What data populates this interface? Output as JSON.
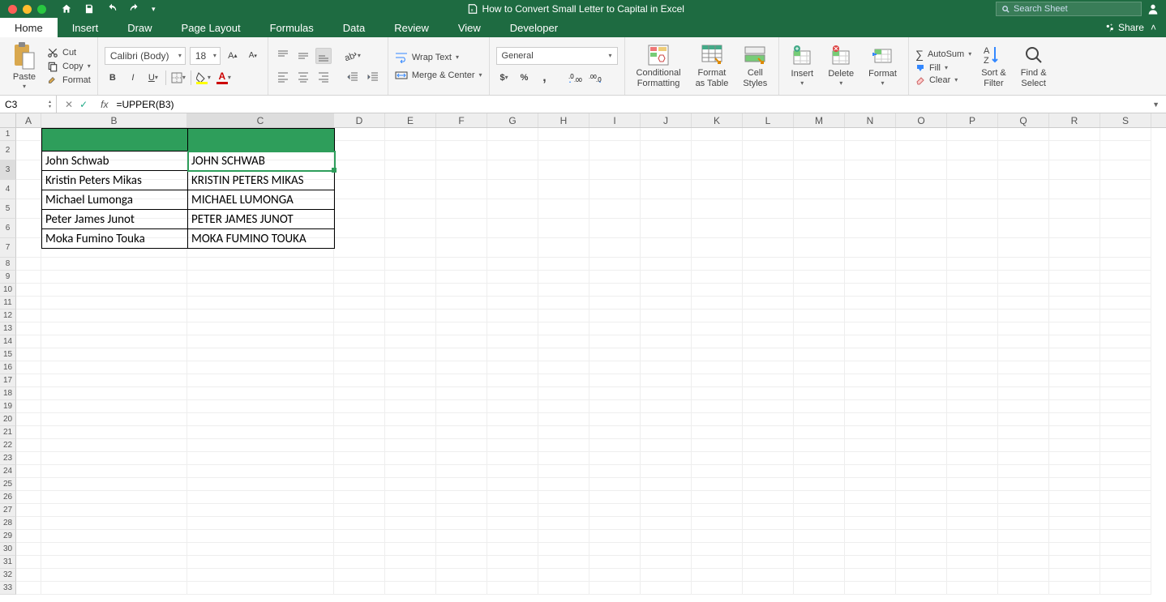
{
  "title": "How to Convert Small Letter to Capital in Excel",
  "search_placeholder": "Search Sheet",
  "tabs": [
    "Home",
    "Insert",
    "Draw",
    "Page Layout",
    "Formulas",
    "Data",
    "Review",
    "View",
    "Developer"
  ],
  "share": "Share",
  "clipboard": {
    "paste": "Paste",
    "cut": "Cut",
    "copy": "Copy",
    "format": "Format"
  },
  "font": {
    "name": "Calibri (Body)",
    "size": "18"
  },
  "align": {
    "wrap": "Wrap Text",
    "merge": "Merge & Center"
  },
  "number": {
    "format": "General"
  },
  "styles": {
    "cond": "Conditional\nFormatting",
    "tbl": "Format\nas Table",
    "cell": "Cell\nStyles"
  },
  "cells": {
    "insert": "Insert",
    "delete": "Delete",
    "format": "Format"
  },
  "editing": {
    "autosum": "AutoSum",
    "fill": "Fill",
    "clear": "Clear",
    "sort": "Sort &\nFilter",
    "find": "Find &\nSelect"
  },
  "namebox": "C3",
  "formula": "=UPPER(B3)",
  "cols": [
    "A",
    "B",
    "C",
    "D",
    "E",
    "F",
    "G",
    "H",
    "I",
    "J",
    "K",
    "L",
    "M",
    "N",
    "O",
    "P",
    "Q",
    "R",
    "S"
  ],
  "rows_count": 33,
  "table": {
    "b": [
      "John Schwab",
      "Kristin Peters Mikas",
      "Michael Lumonga",
      "Peter James Junot",
      "Moka Fumino Touka"
    ],
    "c": [
      "JOHN SCHWAB",
      "KRISTIN PETERS MIKAS",
      "MICHAEL LUMONGA",
      "PETER JAMES JUNOT",
      "MOKA FUMINO TOUKA"
    ]
  }
}
